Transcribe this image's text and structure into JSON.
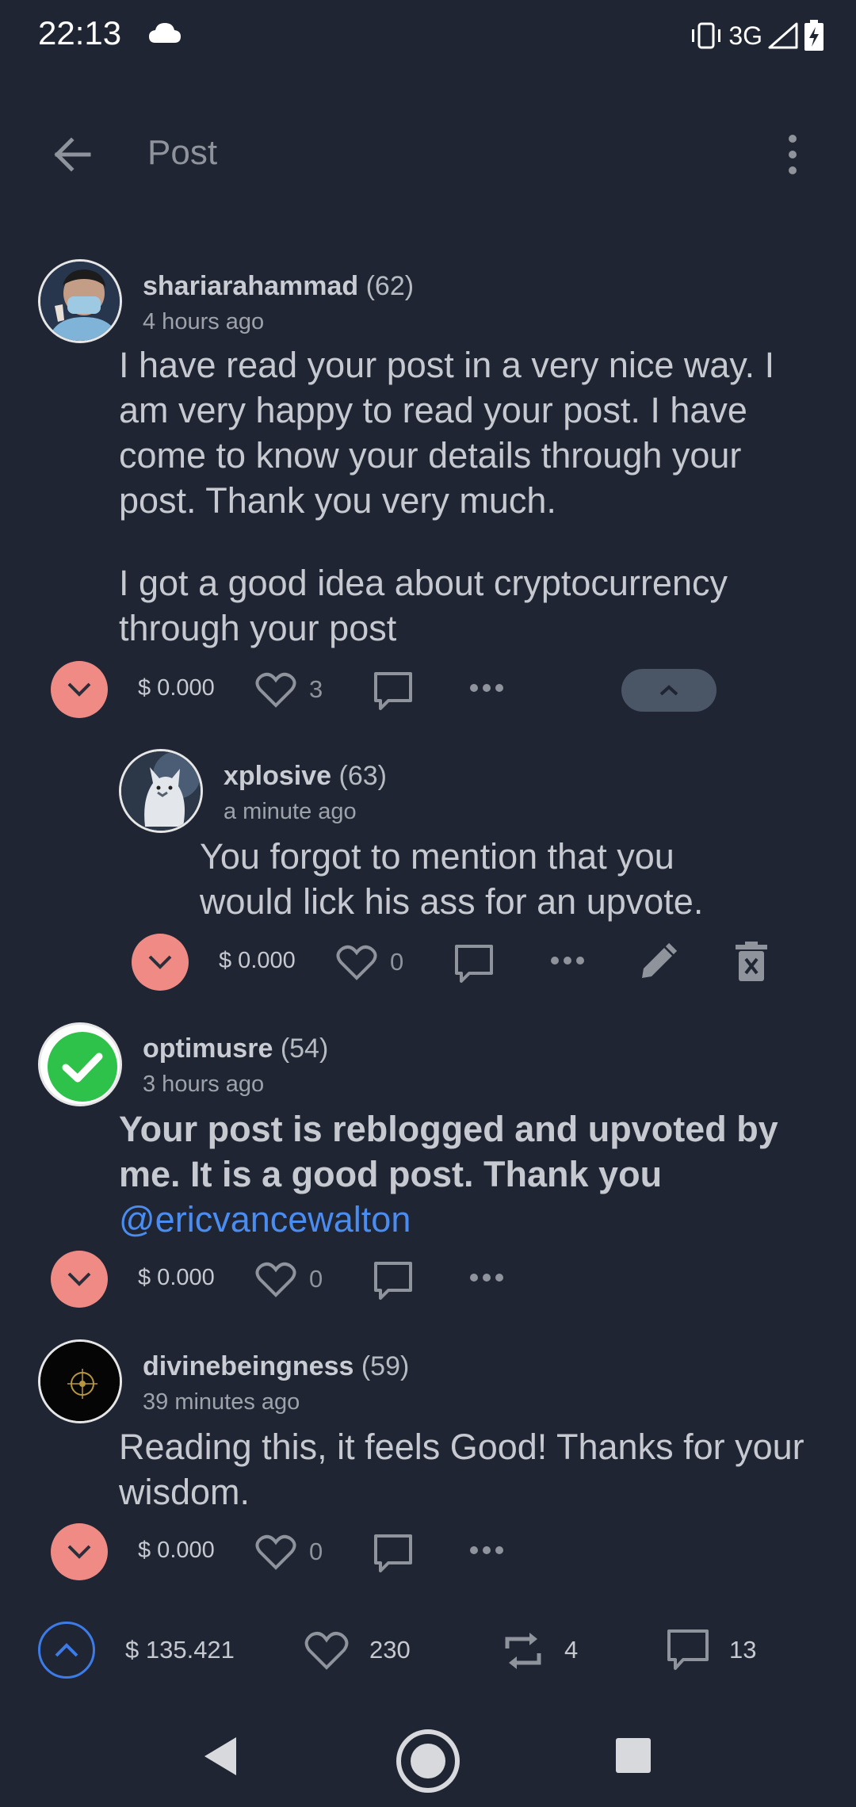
{
  "status_bar": {
    "time": "22:13",
    "network": "3G",
    "icons": [
      "cloud-icon",
      "vibrate-icon",
      "signal-icon",
      "battery-charging-icon"
    ]
  },
  "app_bar": {
    "title": "Post",
    "back_icon": "arrow-left-icon",
    "menu_icon": "more-vertical-icon"
  },
  "colors": {
    "background": "#1f2532",
    "downvote": "#f08a84",
    "mention": "#4a8cf0",
    "upvote_outline": "#3d7be8",
    "muted": "#8e939c"
  },
  "comments": [
    {
      "author": "shariarahammad",
      "reputation": "(62)",
      "time": "4 hours ago",
      "body": [
        "I have read your post in a very nice way. I am very happy to read your post. I have come to know your details through your post. Thank you very much.",
        "I got a good idea about cryptocurrency through your post"
      ],
      "payout": "$ 0.000",
      "likes": "3"
    },
    {
      "author": "xplosive",
      "reputation": "(63)",
      "time": "a minute ago",
      "body": [
        "You forgot to mention that you would lick his ass for an upvote."
      ],
      "payout": "$ 0.000",
      "likes": "0"
    },
    {
      "author": "optimusre",
      "reputation": "(54)",
      "time": "3 hours ago",
      "body_bold": "Your post is reblogged and upvoted by me. It is a good post. Thank you",
      "mention": "@ericvancewalton",
      "payout": "$ 0.000",
      "likes": "0"
    },
    {
      "author": "divinebeingness",
      "reputation": "(59)",
      "time": "39 minutes ago",
      "body": [
        "Reading this, it feels Good! Thanks for your wisdom."
      ],
      "payout": "$ 0.000",
      "likes": "0"
    }
  ],
  "footer": {
    "payout": "$ 135.421",
    "likes": "230",
    "reblogs": "4",
    "comments": "13"
  }
}
